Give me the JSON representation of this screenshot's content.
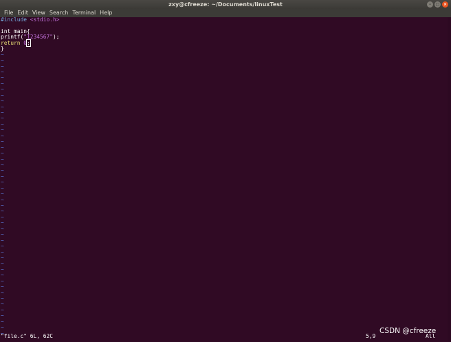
{
  "window": {
    "title": "zxy@cfreeze: ~/Documents/linuxTest",
    "buttons": {
      "minimize": "–",
      "maximize": "□",
      "close": "×"
    }
  },
  "menu": [
    "File",
    "Edit",
    "View",
    "Search",
    "Terminal",
    "Help"
  ],
  "code": {
    "include_kw": "#include",
    "include_hdr": "<stdio.h>",
    "main_sig": "int main{",
    "printf_fn": "printf(",
    "printf_str": "\"1234567\"",
    "printf_end": ");",
    "return_kw": "return",
    "return_val": "0",
    "cursor_char": ";",
    "close_brace": "}"
  },
  "tilde": "~",
  "tilde_count": 49,
  "status": {
    "file_info": "\"file.c\" 6L, 62C",
    "position": "5,9",
    "scroll": "All"
  },
  "watermark": "CSDN @cfreeze",
  "colors": {
    "background": "#300a24",
    "preproc": "#76aee3",
    "string": "#c070d8",
    "keyword": "#e6db74",
    "tilde": "#5c7ce0"
  }
}
